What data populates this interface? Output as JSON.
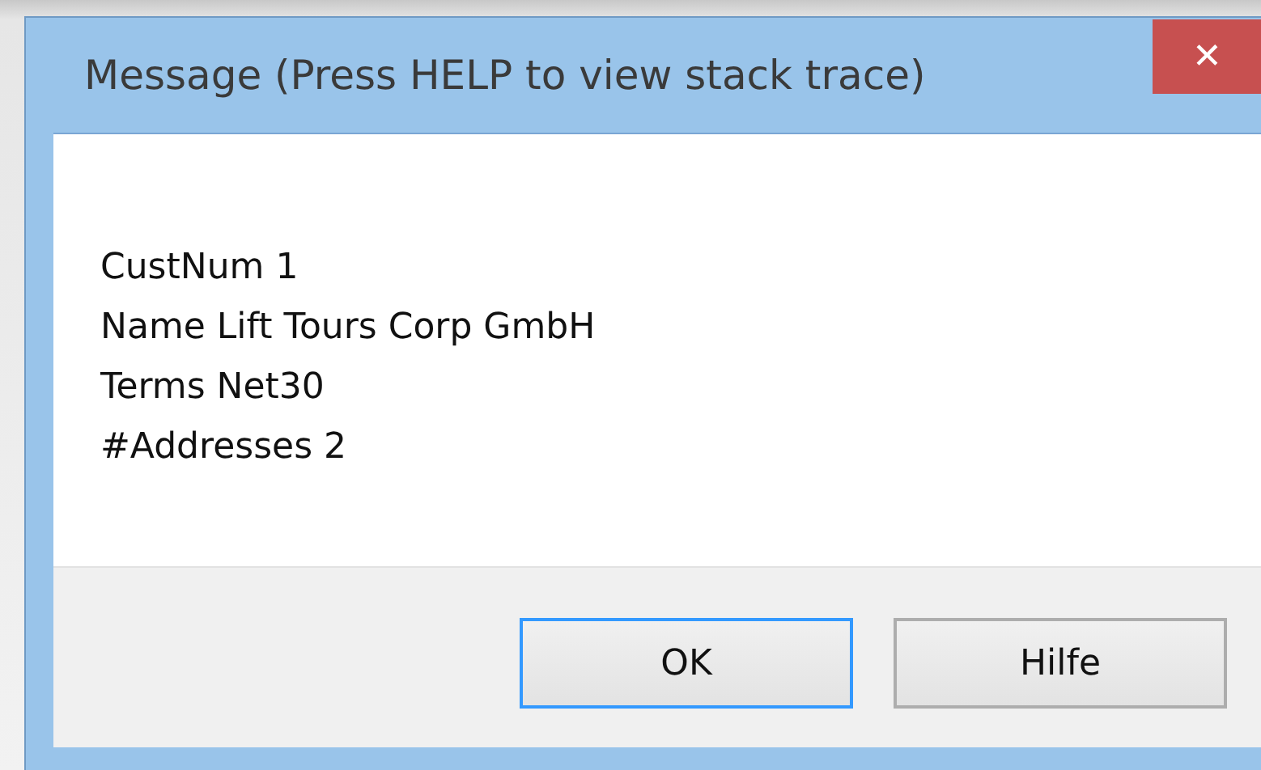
{
  "window": {
    "title": "Message (Press HELP to view stack trace)",
    "close": "✕"
  },
  "message": {
    "lines": [
      "CustNum 1",
      "Name Lift Tours Corp GmbH",
      "Terms Net30",
      "#Addresses 2"
    ]
  },
  "buttons": [
    {
      "label": "OK",
      "focused": true
    },
    {
      "label": "Hilfe",
      "focused": false
    }
  ]
}
